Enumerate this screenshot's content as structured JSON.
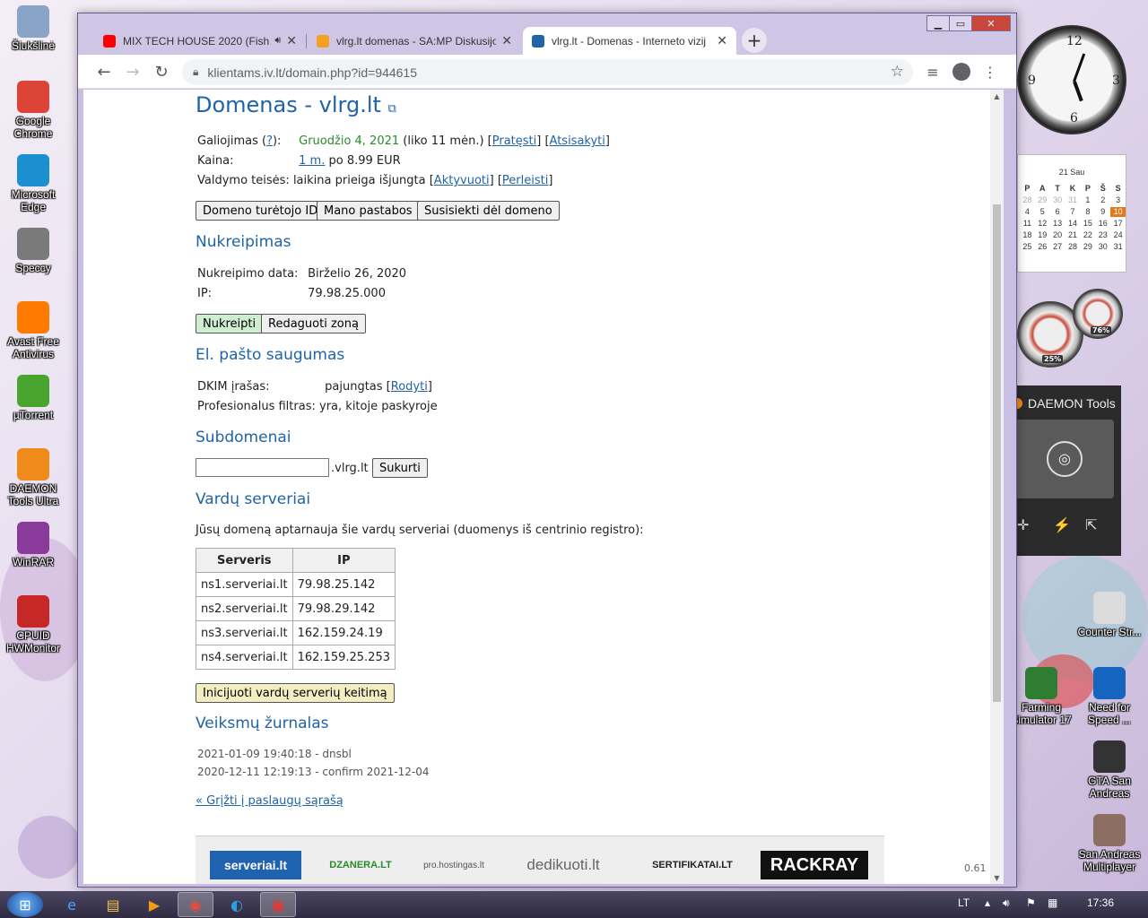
{
  "desktop": {
    "icons_left": [
      {
        "label": "Šiukšlinė",
        "icon": "recycle-bin-icon",
        "color": "#8aa4c8"
      },
      {
        "label": "Google Chrome",
        "icon": "chrome-icon",
        "color": "#db4437"
      },
      {
        "label": "Microsoft Edge",
        "icon": "edge-icon",
        "color": "#1b8fcf"
      },
      {
        "label": "Speccy",
        "icon": "speccy-icon",
        "color": "#7a7a7a"
      },
      {
        "label": "Avast Free Antivirus",
        "icon": "avast-icon",
        "color": "#ff7a00"
      },
      {
        "label": "µTorrent",
        "icon": "utorrent-icon",
        "color": "#4aa52e"
      },
      {
        "label": "DAEMON Tools Ultra",
        "icon": "daemon-tools-icon",
        "color": "#f08a1a"
      },
      {
        "label": "WinRAR",
        "icon": "winrar-icon",
        "color": "#8a3a9a"
      },
      {
        "label": "CPUID HWMonitor",
        "icon": "hwmonitor-icon",
        "color": "#c62828"
      }
    ],
    "icons_right": [
      {
        "label": "Counter Str...",
        "icon": "counter-strike-icon",
        "color": "#dcdcdc"
      },
      {
        "label": "Farming Simulator 17",
        "icon": "farming-simulator-icon",
        "color": "#2e7d32"
      },
      {
        "label": "Need for Speed ...",
        "icon": "need-for-speed-icon",
        "color": "#1565c0"
      },
      {
        "label": "GTA San Andreas",
        "icon": "gta-icon",
        "color": "#333333"
      },
      {
        "label": "San Andreas Multiplayer",
        "icon": "samp-icon",
        "color": "#8d6e63"
      }
    ]
  },
  "browser": {
    "tabs": [
      {
        "title": "MIX TECH HOUSE 2020 (Fish",
        "icon": "youtube-icon",
        "color": "#ff0000",
        "audio_icon": "speaker-icon"
      },
      {
        "title": "vlrg.lt domenas - SA:MP Diskusijo",
        "icon": "forum-icon",
        "color": "#f4a020"
      },
      {
        "title": "vlrg.lt - Domenas - Interneto vizij",
        "icon": "iv-icon",
        "color": "#1f63a8"
      }
    ],
    "new_tab": "+",
    "url": "klientams.iv.lt/domain.php?id=944615"
  },
  "page": {
    "title": "Domenas - vlrg.lt",
    "expiry": {
      "label": "Galiojimas (",
      "help": "?",
      "label_end": "):",
      "date": "Gruodžio 4, 2021",
      "left": "(liko 11 mėn.)",
      "renew": "Pratęsti",
      "cancel": "Atsisakyti"
    },
    "price": {
      "label": "Kaina:",
      "period": "1 m.",
      "value": "po 8.99 EUR"
    },
    "rights": {
      "label": "Valdymo teisės:",
      "value": "laikina prieiga išjungta",
      "activate": "Aktyvuoti",
      "transfer": "Perleisti"
    },
    "buttons": {
      "owner_id": "Domeno turėtojo ID",
      "notes": "Mano pastabos",
      "contact": "Susisiekti dėl domeno"
    },
    "redirect": {
      "heading": "Nukreipimas",
      "date_label": "Nukreipimo data:",
      "date": "Birželio 26, 2020",
      "ip_label": "IP:",
      "ip": "79.98.25.000",
      "btn_redirect": "Nukreipti",
      "btn_edit_zone": "Redaguoti zoną"
    },
    "email_security": {
      "heading": "El. pašto saugumas",
      "dkim_label": "DKIM įrašas:",
      "dkim_value": "pajungtas",
      "dkim_show": "Rodyti",
      "filter_label": "Profesionalus filtras:",
      "filter_value": "yra, kitoje paskyroje"
    },
    "subdomains": {
      "heading": "Subdomenai",
      "input_value": "",
      "suffix": ".vlrg.lt",
      "create": "Sukurti"
    },
    "nameservers": {
      "heading": "Vardų serveriai",
      "intro": "Jūsų domeną aptarnauja šie vardų serveriai (duomenys iš centrinio registro):",
      "columns": [
        "Serveris",
        "IP"
      ],
      "rows": [
        [
          "ns1.serveriai.lt",
          "79.98.25.142"
        ],
        [
          "ns2.serveriai.lt",
          "79.98.29.142"
        ],
        [
          "ns3.serveriai.lt",
          "162.159.24.19"
        ],
        [
          "ns4.serveriai.lt",
          "162.159.25.253"
        ]
      ],
      "change_btn": "Inicijuoti vardų serverių keitimą"
    },
    "log": {
      "heading": "Veiksmų žurnalas",
      "entries": [
        "2021-01-09 19:40:18 - dnsbl",
        "2020-12-11 12:19:13 - confirm 2021-12-04"
      ]
    },
    "back_link": "« Grįžti į paslaugų sąrašą",
    "footer_logos": [
      "serveriai.lt",
      "DZANERA.LT",
      "pro.hostingas.lt",
      "dedikuoti.lt",
      "SERTIFIKATAI.LT",
      "RACKRAY"
    ],
    "version": "0.61"
  },
  "gadgets": {
    "calendar": {
      "month": "21 Sau",
      "weekdays": [
        "P",
        "A",
        "T",
        "K",
        "P",
        "Š",
        "S"
      ],
      "days": [
        "28",
        "29",
        "30",
        "31",
        "1",
        "2",
        "3",
        "4",
        "5",
        "6",
        "7",
        "8",
        "9",
        "10",
        "11",
        "12",
        "13",
        "14",
        "15",
        "16",
        "17",
        "18",
        "19",
        "20",
        "21",
        "22",
        "23",
        "24",
        "25",
        "26",
        "27",
        "28",
        "29",
        "30",
        "31"
      ],
      "today": "10"
    },
    "cpu_percent": "25%",
    "ram_percent": "76%",
    "daemon_title": "DAEMON Tools"
  },
  "taskbar": {
    "language": "LT",
    "time": "17:36"
  }
}
